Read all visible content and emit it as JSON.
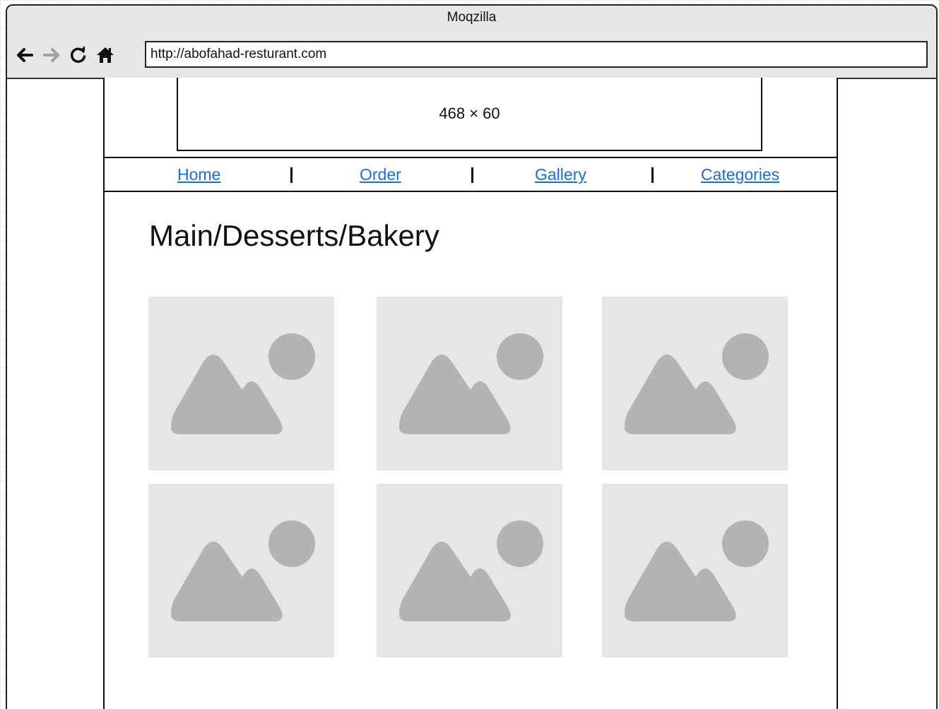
{
  "browser": {
    "title": "Moqzilla",
    "url": "http://abofahad-resturant.com",
    "icons": [
      "back-arrow-icon",
      "forward-arrow-icon",
      "reload-icon",
      "home-icon"
    ]
  },
  "banner": {
    "label": "468 × 60"
  },
  "menu": {
    "items": [
      {
        "label": "Home"
      },
      {
        "label": "Order"
      },
      {
        "label": "Gallery"
      },
      {
        "label": "Categories"
      }
    ],
    "separator": "|"
  },
  "page": {
    "heading": "Main/Desserts/Bakery"
  },
  "gallery": {
    "images": [
      {
        "icon": "image-placeholder-icon"
      },
      {
        "icon": "image-placeholder-icon"
      },
      {
        "icon": "image-placeholder-icon"
      },
      {
        "icon": "image-placeholder-icon"
      },
      {
        "icon": "image-placeholder-icon"
      },
      {
        "icon": "image-placeholder-icon"
      }
    ]
  },
  "colors": {
    "link": "#1a6fe0",
    "placeholder_bg": "#e6e6e6",
    "placeholder_fg": "#b3b3b3",
    "chrome": "#e6e6e6"
  }
}
